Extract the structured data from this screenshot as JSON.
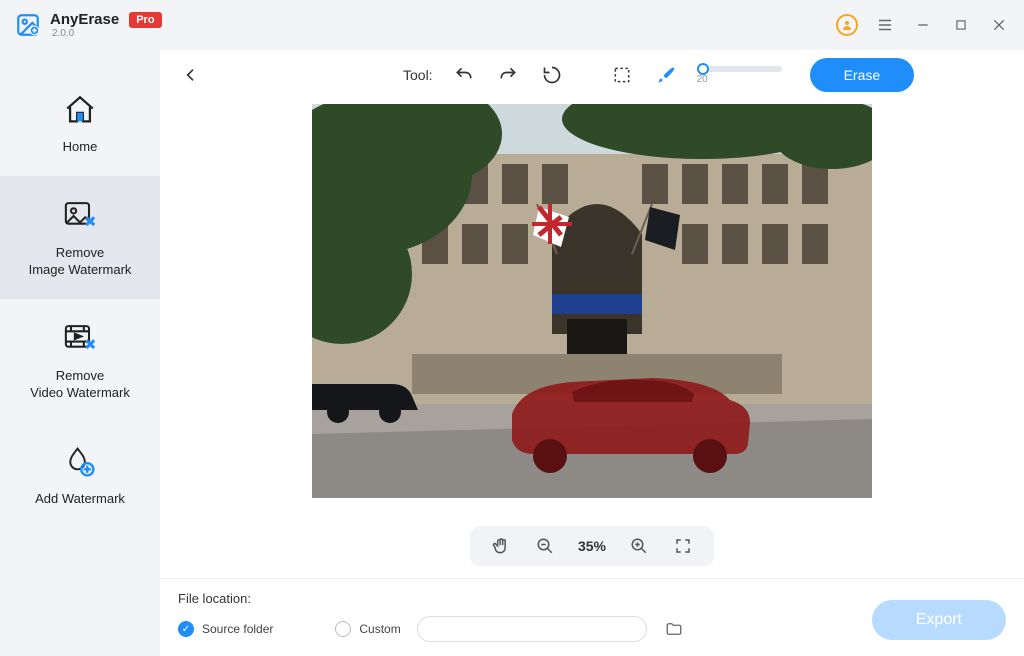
{
  "app": {
    "name": "AnyErase",
    "badge": "Pro",
    "version": "2.0.0"
  },
  "sidebar": {
    "items": [
      {
        "label": "Home"
      },
      {
        "label": "Remove\nImage Watermark"
      },
      {
        "label": "Remove\nVideo Watermark"
      },
      {
        "label": "Add Watermark"
      }
    ]
  },
  "toolbar": {
    "tool_label": "Tool:",
    "brush_size": "20",
    "erase_label": "Erase"
  },
  "zoom": {
    "level": "35%"
  },
  "footer": {
    "location_label": "File location:",
    "source_label": "Source folder",
    "custom_label": "Custom",
    "export_label": "Export"
  }
}
